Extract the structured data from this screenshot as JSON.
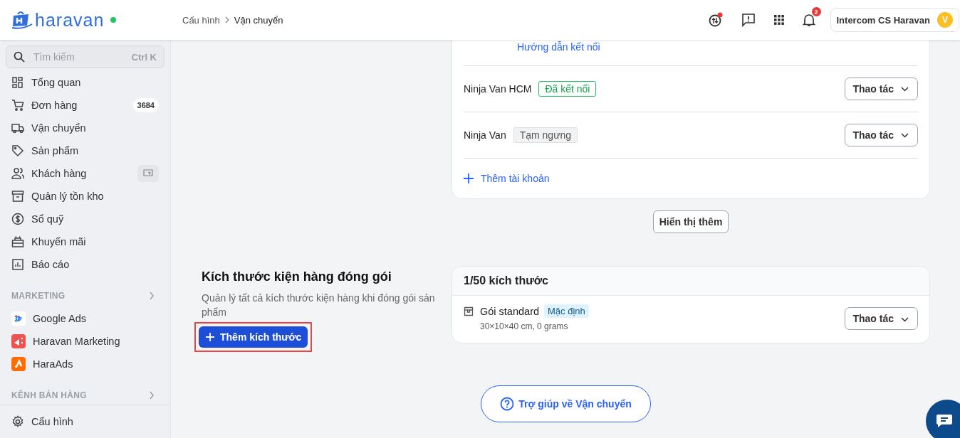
{
  "header": {
    "logo_text": "haravan",
    "breadcrumb": [
      "Cấu hình",
      "Vận chuyển"
    ],
    "notification_count": "2",
    "account": {
      "name": "Intercom CS Haravan",
      "initial": "V"
    }
  },
  "sidebar": {
    "search": {
      "placeholder": "Tìm kiếm",
      "shortcut": "Ctrl K"
    },
    "items": [
      {
        "label": "Tổng quan"
      },
      {
        "label": "Đơn hàng",
        "badge": "3684"
      },
      {
        "label": "Vận chuyển"
      },
      {
        "label": "Sản phẩm"
      },
      {
        "label": "Khách hàng"
      },
      {
        "label": "Quản lý tồn kho"
      },
      {
        "label": "Sổ quỹ"
      },
      {
        "label": "Khuyến mãi"
      },
      {
        "label": "Báo cáo"
      }
    ],
    "sections": [
      {
        "title": "MARKETING",
        "items": [
          {
            "label": "Google Ads"
          },
          {
            "label": "Haravan Marketing"
          },
          {
            "label": "HaraAds"
          }
        ]
      },
      {
        "title": "KÊNH BÁN HÀNG"
      }
    ],
    "footer_item": "Cấu hình"
  },
  "carriers": {
    "guide_link": "Hướng dẫn kết nối",
    "accounts": [
      {
        "name": "Ninja Van HCM",
        "status": "Đã kết nối",
        "kind": "connected",
        "action": "Thao tác"
      },
      {
        "name": "Ninja Van",
        "status": "Tạm ngưng",
        "kind": "paused",
        "action": "Thao tác"
      }
    ],
    "add_account": "Thêm tài khoản",
    "show_more": "Hiển thị thêm"
  },
  "packages": {
    "title": "Kích thước kiện hàng đóng gói",
    "description": "Quản lý tất cả kích thước kiện hàng khi đóng gói sản phẩm",
    "add_button": "Thêm kích thước",
    "highlighted": true,
    "count": "1/50 kích thước",
    "items": [
      {
        "name": "Gói standard",
        "tag": "Mặc định",
        "detail": "30×10×40 cm, 0 grams",
        "action": "Thao tác"
      }
    ]
  },
  "help_button": "Trợ giúp về Vận chuyển"
}
